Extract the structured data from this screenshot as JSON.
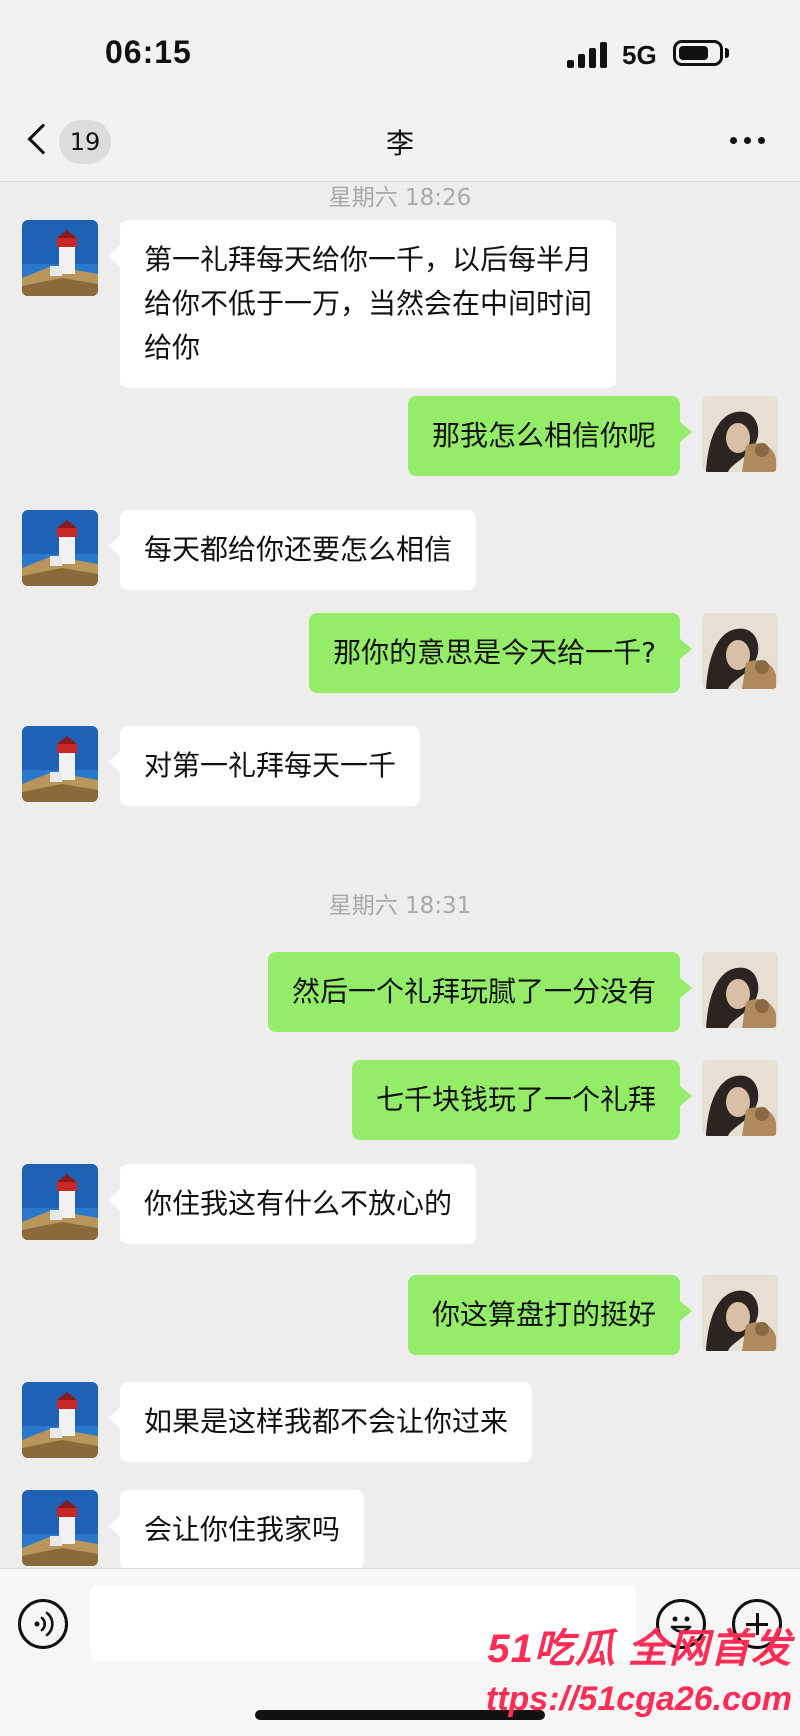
{
  "status_bar": {
    "time": "06:15",
    "network": "5G",
    "battery_level": 0.75
  },
  "nav": {
    "back_count": "19",
    "title": "李"
  },
  "messages": [
    {
      "type": "timestamp",
      "text": "星期六 18:26"
    },
    {
      "type": "in",
      "text": "第一礼拜每天给你一千，以后每半月\n给你不低于一万，当然会在中间时间\n给你"
    },
    {
      "type": "out",
      "text": "那我怎么相信你呢"
    },
    {
      "type": "in",
      "text": "每天都给你还要怎么相信"
    },
    {
      "type": "out",
      "text": "那你的意思是今天给一千?"
    },
    {
      "type": "in",
      "text": "对第一礼拜每天一千"
    },
    {
      "type": "timestamp",
      "text": "星期六 18:31"
    },
    {
      "type": "out",
      "text": "然后一个礼拜玩腻了一分没有"
    },
    {
      "type": "out",
      "text": "七千块钱玩了一个礼拜"
    },
    {
      "type": "in",
      "text": "你住我这有什么不放心的"
    },
    {
      "type": "out",
      "text": "你这算盘打的挺好"
    },
    {
      "type": "in",
      "text": "如果是这样我都不会让你过来"
    },
    {
      "type": "in",
      "text": "会让你住我家吗"
    }
  ],
  "input": {
    "value": "",
    "placeholder": ""
  },
  "icons": {
    "voice": "voice-icon",
    "emoji": "emoji-icon",
    "plus": "plus-icon",
    "more": "more-icon",
    "back": "back-icon"
  },
  "colors": {
    "bubble_out": "#95ec69",
    "bubble_in": "#ffffff",
    "background": "#ededed"
  },
  "watermark": {
    "brand": "51吃瓜 全网首发",
    "url": "ttps://51cga26.com"
  }
}
